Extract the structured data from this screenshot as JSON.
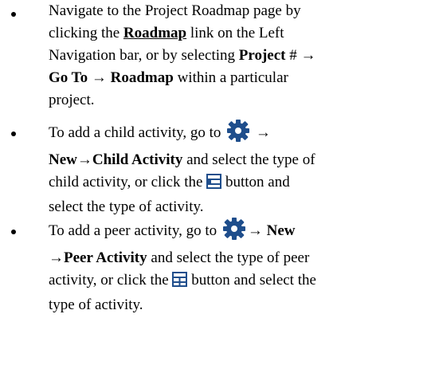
{
  "bullets": [
    {
      "lines": [
        {
          "t1": "Navigate to the Project Roadmap page by"
        },
        {
          "t1": "clicking the ",
          "b1": "Roadmap",
          "t2": " link on the Left"
        },
        {
          "t1": "Navigation bar, or by selecting ",
          "b1": "Project",
          "t2": " # ",
          "arrow": "→"
        },
        {
          "b1": "Go To ",
          "arrow": "→",
          "b2": " Roadmap",
          "t2": " within a particular"
        },
        {
          "t1": "project."
        }
      ]
    },
    {
      "lines": [
        {
          "t1": "To add a child activity, go to ",
          "arrow": "→"
        },
        {
          "b1": "New",
          "arrow": "→",
          "b2": "Child Activity",
          "t2": " and select the type of"
        },
        {
          "t1": "child activity, or click the ",
          "t2": "  button and"
        },
        {
          "t1": "select the type of activity."
        }
      ]
    },
    {
      "lines": [
        {
          "t1": "To add a peer activity, go to ",
          "arrow": "→",
          "b1": " New"
        },
        {
          "arrow": "→",
          "b1": "Peer Activity",
          "t1": " and select the type of peer"
        },
        {
          "t1": "activity, or click the ",
          "t2": " button and select the"
        },
        {
          "t1": "type of activity."
        }
      ]
    }
  ],
  "icons": {
    "gear": "gear-icon",
    "add_child": "add-child-activity-icon",
    "add_peer": "add-peer-activity-icon"
  },
  "colors": {
    "text": "#000000",
    "icon_blue": "#1f4e8c"
  }
}
